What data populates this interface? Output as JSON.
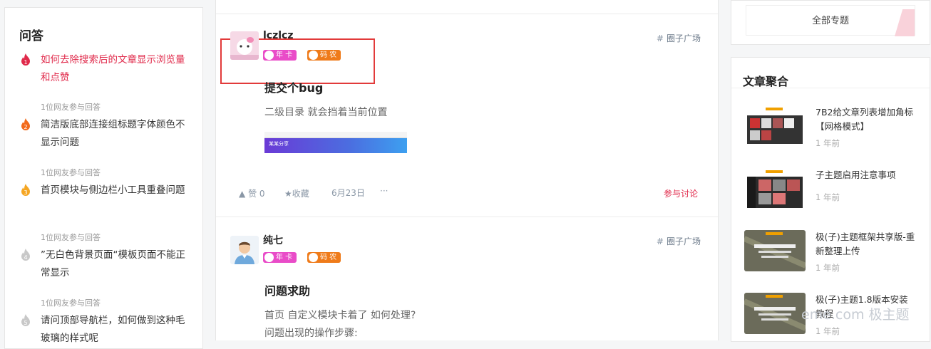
{
  "left": {
    "title": "问答",
    "items": [
      {
        "num": "1",
        "title": "如何去除搜索后的文章显示浏览量和点赞",
        "meta": "1位网友参与回答",
        "hot": true,
        "color": "#e0294a"
      },
      {
        "num": "2",
        "title": "简洁版底部连接组标题字体颜色不显示问题",
        "meta": "1位网友参与回答",
        "hot": false,
        "color": "#f26a1b"
      },
      {
        "num": "3",
        "title": "首页模块与侧边栏小工具重叠问题",
        "meta": "1位网友参与回答",
        "hot": false,
        "color": "#f5a623"
      },
      {
        "num": "4",
        "title": "”无白色背景页面“模板页面不能正常显示",
        "meta": "1位网友参与回答",
        "hot": false,
        "color": "#c8c8c8"
      },
      {
        "num": "5",
        "title": "请问顶部导航栏，如何做到这种毛玻璃的样式呢",
        "meta": "",
        "hot": false,
        "color": "#c8c8c8"
      }
    ]
  },
  "posts": [
    {
      "author": "lczlcz",
      "badge1": "年 卡",
      "badge2": "码 农",
      "tag": "圈子广场",
      "title": "提交个bug",
      "text": "二级目录 就会挡着当前位置",
      "image_caption": "某某分享",
      "likes": "赞 0",
      "fav": "收藏",
      "date": "6月23日",
      "more": "···",
      "join": "参与讨论"
    },
    {
      "author": "纯七",
      "badge1": "年 卡",
      "badge2": "码 农",
      "tag": "圈子广场",
      "title": "问题求助",
      "text1": "首页 自定义模块卡着了 如何处理?",
      "text2": "问题出现的操作步骤:"
    }
  ],
  "right": {
    "topic_button": "全部专题",
    "aggregate_title": "文章聚合",
    "articles": [
      {
        "title": "7B2给文章列表增加角标【网格模式】",
        "date": "1 年前"
      },
      {
        "title": "子主题启用注意事项",
        "date": "1 年前"
      },
      {
        "title": "极(子)主题框架共享版-重新整理上传",
        "date": "1 年前"
      },
      {
        "title": "极(子)主题1.8版本安装教程",
        "date": "1 年前"
      }
    ]
  },
  "watermark": "eme.com 极主题",
  "colors": {
    "accent": "#e0294a",
    "badge_pink": "#e94cc8",
    "badge_orange": "#ef7b1a",
    "highlight": "#e23a3a"
  }
}
